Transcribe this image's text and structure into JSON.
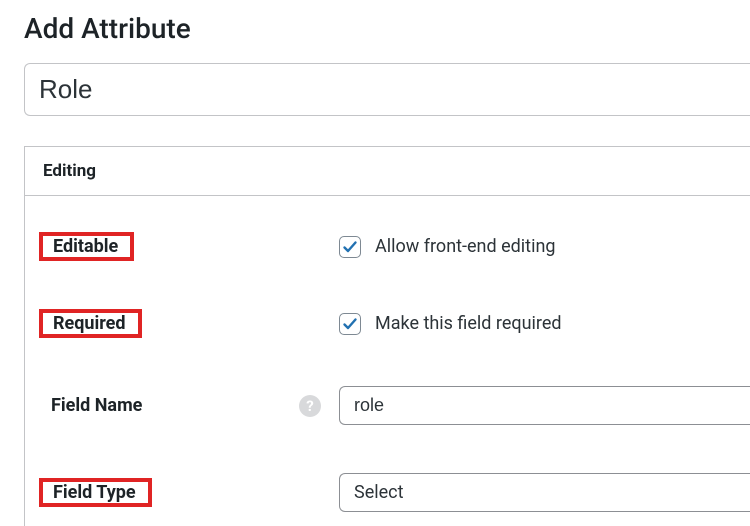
{
  "title": "Add Attribute",
  "title_input_value": "Role",
  "panel": {
    "header": "Editing",
    "rows": {
      "editable": {
        "label": "Editable",
        "checked": true,
        "checkbox_label": "Allow front-end editing"
      },
      "required": {
        "label": "Required",
        "checked": true,
        "checkbox_label": "Make this field required"
      },
      "field_name": {
        "label": "Field Name",
        "help": "?",
        "value": "role"
      },
      "field_type": {
        "label": "Field Type",
        "value": "Select"
      }
    }
  }
}
